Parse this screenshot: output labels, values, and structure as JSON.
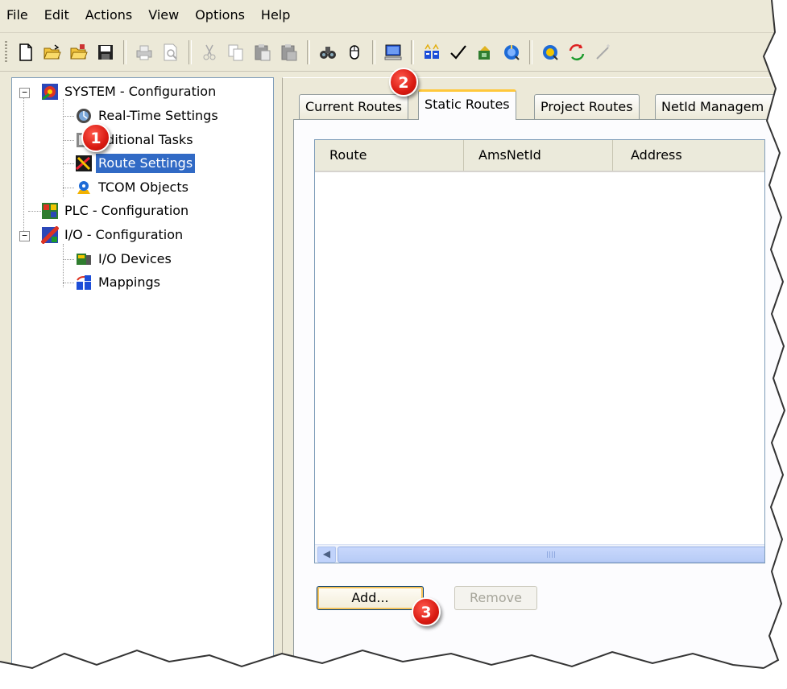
{
  "menu": [
    "File",
    "Edit",
    "Actions",
    "View",
    "Options",
    "Help"
  ],
  "toolbar": {
    "icons": [
      "new-icon",
      "open-icon",
      "open-folder-icon",
      "save-icon",
      "print-icon",
      "print-preview-icon",
      "cut-icon",
      "copy-icon",
      "paste-icon",
      "paste-special-icon",
      "find-icon",
      "mouse-icon",
      "monitor-icon",
      "config-mode-icon",
      "check-icon",
      "activate-icon",
      "restart-icon",
      "target-icon",
      "refresh-icon",
      "wand-icon"
    ]
  },
  "tree": {
    "system": "SYSTEM - Configuration",
    "realtime": "Real-Time Settings",
    "additional_tasks": "dditional Tasks",
    "route_settings": "Route Settings",
    "tcom": "TCOM Objects",
    "plc": "PLC - Configuration",
    "io": "I/O - Configuration",
    "io_devices": "I/O Devices",
    "mappings": "Mappings"
  },
  "tabs": [
    "Current Routes",
    "Static Routes",
    "Project Routes",
    "NetId Managem"
  ],
  "active_tab": "Static Routes",
  "list": {
    "columns": [
      "Route",
      "AmsNetId",
      "Address"
    ]
  },
  "buttons": {
    "add": "Add...",
    "remove": "Remove"
  },
  "callouts": [
    "1",
    "2",
    "3"
  ],
  "colors": {
    "selection": "#316ac5",
    "callout": "#d91a12",
    "active_tab_accent": "#ffc83c"
  }
}
